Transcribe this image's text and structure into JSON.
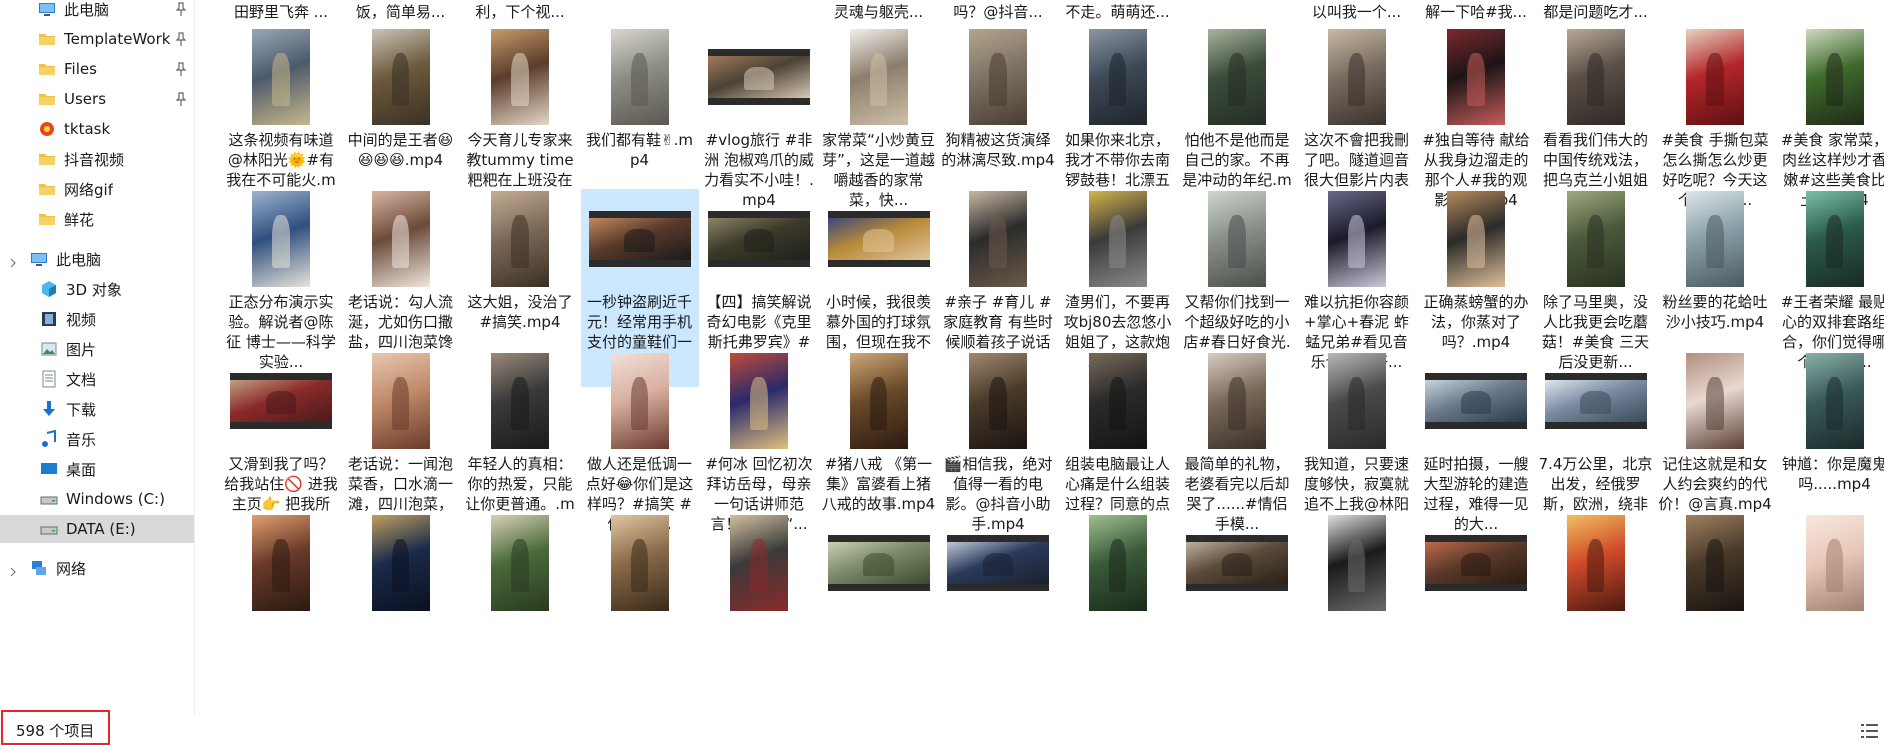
{
  "sidebar": {
    "items": [
      {
        "label": "此电脑",
        "icon": "pc-icon",
        "pinned": true,
        "y": 0
      },
      {
        "label": "TemplateWork",
        "icon": "folder-icon",
        "pinned": true,
        "y": 1
      },
      {
        "label": "Files",
        "icon": "folder-icon",
        "pinned": true,
        "y": 2
      },
      {
        "label": "Users",
        "icon": "folder-icon",
        "pinned": true,
        "y": 3
      },
      {
        "label": "tktask",
        "icon": "app-icon",
        "pinned": false,
        "y": 4
      },
      {
        "label": "抖音视频",
        "icon": "folder-icon",
        "pinned": false,
        "y": 5
      },
      {
        "label": "网络gif",
        "icon": "folder-icon",
        "pinned": false,
        "y": 6
      },
      {
        "label": "鲜花",
        "icon": "folder-icon",
        "pinned": false,
        "y": 7
      }
    ],
    "this_pc": {
      "label": "此电脑"
    },
    "pc_children": [
      {
        "label": "3D 对象",
        "icon": "cube-icon"
      },
      {
        "label": "视频",
        "icon": "video-icon"
      },
      {
        "label": "图片",
        "icon": "picture-icon"
      },
      {
        "label": "文档",
        "icon": "document-icon"
      },
      {
        "label": "下载",
        "icon": "download-icon"
      },
      {
        "label": "音乐",
        "icon": "music-icon"
      },
      {
        "label": "桌面",
        "icon": "desktop-icon"
      },
      {
        "label": "Windows (C:)",
        "icon": "drive-icon"
      },
      {
        "label": "DATA (E:)",
        "icon": "drive-icon",
        "selected": true
      }
    ],
    "network": {
      "label": "网络"
    }
  },
  "files": {
    "top_row": [
      "田野里飞奔 ...",
      "饭，简单易...",
      "利，下个视...",
      "",
      "",
      "灵魂与躯壳...",
      "吗？@抖音...",
      "不走。萌萌还...",
      "",
      "以叫我一个...",
      "解一下哈#我...",
      "都是问题吃才..."
    ],
    "rows": [
      [
        {
          "name": "这条视频有味道@林阳光🌞#有我在不可能火.mp4",
          "kind": "portrait",
          "colors": [
            "#4b5a6b",
            "#9aa7b5",
            "#c7b88a"
          ]
        },
        {
          "name": "中间的是王者😆😆😆😆.mp4",
          "kind": "portrait",
          "colors": [
            "#6e5a3c",
            "#c9c3b8",
            "#3a3024"
          ]
        },
        {
          "name": "今天育儿专家来教tummy time粑粑在上班没在场 遗...",
          "kind": "portrait",
          "colors": [
            "#5a3d2a",
            "#c89b6c",
            "#e5d7c7"
          ]
        },
        {
          "name": "我们都有鞋✌.mp4",
          "kind": "portrait",
          "colors": [
            "#8d8f86",
            "#d9d6cf",
            "#5b5750"
          ]
        },
        {
          "name": "#vlog旅行 #非洲 泡椒鸡爪的威力看实不小哇！.mp4",
          "kind": "landscape",
          "colors": [
            "#4b4235",
            "#a07a58",
            "#d8c8b5"
          ]
        },
        {
          "name": "家常菜“小炒黄豆芽”，这是一道越嚼越香的家常菜，快...",
          "kind": "portrait",
          "colors": [
            "#8b7e6d",
            "#f2f0eb",
            "#cdbfa7"
          ]
        },
        {
          "name": "狗精被这货演绎的淋漓尽致.mp4",
          "kind": "portrait",
          "colors": [
            "#7d7466",
            "#b5a48d",
            "#4a3d31"
          ]
        },
        {
          "name": "如果你来北京，我才不带你去南锣鼓巷！北漂五年...",
          "kind": "portrait",
          "colors": [
            "#3e4a57",
            "#8a96a3",
            "#1e242b"
          ]
        },
        {
          "name": "怕他不是他而是自己的家。不再是冲动的年纪.mp4",
          "kind": "portrait",
          "colors": [
            "#3b4d3a",
            "#a7b39e",
            "#252d24"
          ]
        },
        {
          "name": "这次不會把我刪了吧。隧道迴音很大但影片内表現不...",
          "kind": "portrait",
          "colors": [
            "#7a6d60",
            "#c9b9a6",
            "#3a322b"
          ]
        },
        {
          "name": "#独自等待 献给从我身边溜走的那个人#我的观影报告.mp4",
          "kind": "portrait",
          "colors": [
            "#1c1416",
            "#7a2a2e",
            "#c65d5a"
          ]
        },
        {
          "name": "看看我们伟大的中国传统戏法，把乌克兰小姐姐彻底...",
          "kind": "portrait",
          "colors": [
            "#5a5048",
            "#b8a898",
            "#2f2824"
          ]
        },
        {
          "name": "#美食 手撕包菜怎么撕怎么炒更好吃呢？今天这个小窍门...",
          "kind": "portrait",
          "colors": [
            "#b3262a",
            "#e6d3c2",
            "#5e1013"
          ]
        },
        {
          "name": "#美食 家常菜，肉丝这样炒才香嫩#这些美食比土香.mp4",
          "kind": "portrait",
          "colors": [
            "#3f6b2c",
            "#cfd9c2",
            "#1f2a17"
          ]
        }
      ],
      [
        {
          "name": "正态分布演示实验。解说者@陈征 博士——科学实验...",
          "kind": "portrait",
          "colors": [
            "#2f4f7f",
            "#9db4cf",
            "#e7e4d9"
          ]
        },
        {
          "name": "老话说：勾人流涎，尤如伤口撒盐，四川泡菜馋确食...",
          "kind": "portrait",
          "colors": [
            "#6b4a3a",
            "#d9b6a2",
            "#f0e6de"
          ]
        },
        {
          "name": "这大姐，没治了#搞笑.mp4",
          "kind": "portrait",
          "colors": [
            "#7c6a58",
            "#c4ad94",
            "#3a2f25"
          ]
        },
        {
          "name": "一秒钟盗刷近千元！经常用手机支付的童鞋们一定要...",
          "kind": "landscape",
          "colors": [
            "#5a3a2a",
            "#c08960",
            "#1a1a1a"
          ],
          "selected": true
        },
        {
          "name": "【四】搞笑解说奇幻电影《克里斯托弗罗宾》#电影 #...",
          "kind": "landscape",
          "colors": [
            "#3d3a2a",
            "#8a8566",
            "#20201a"
          ]
        },
        {
          "name": "小时候，我很羡慕外国的打球氛围，但现在我不会，因...",
          "kind": "landscape",
          "colors": [
            "#b88a3a",
            "#3a4a7a",
            "#e0c49a"
          ]
        },
        {
          "name": "#亲子 #育儿 #家庭教育 有些时候顺着孩子说话往往更...",
          "kind": "portrait",
          "colors": [
            "#2b2b2b",
            "#c9b7a3",
            "#6a5a4a"
          ]
        },
        {
          "name": "渣男们，不要再攻bj80去忽悠小姐姐了，这款炮才是真...",
          "kind": "portrait",
          "colors": [
            "#3a3a3a",
            "#d4b44a",
            "#8a8a8a"
          ]
        },
        {
          "name": "又帮你们找到一个超级好吃的小店#春日好食光.mp4",
          "kind": "portrait",
          "colors": [
            "#8a8f8a",
            "#cfd4cf",
            "#4a4f4a"
          ]
        },
        {
          "name": "难以抗拒你容颜+掌心+春泥 蚱蜢兄弟#看见音乐计划 #好...",
          "kind": "portrait",
          "colors": [
            "#1a1a2a",
            "#6a6a8a",
            "#c9c9d9"
          ]
        },
        {
          "name": "正确蒸螃蟹的办法，你蒸对了吗？.mp4",
          "kind": "portrait",
          "colors": [
            "#2a2a2a",
            "#b88a5a",
            "#e0c09a"
          ]
        },
        {
          "name": "除了马里奥，没人比我更会吃蘑菇！#美食 三天后没更新...",
          "kind": "portrait",
          "colors": [
            "#4a5a3a",
            "#a0a880",
            "#2a3020"
          ]
        },
        {
          "name": "粉丝要的花蛤吐沙小技巧.mp4",
          "kind": "portrait",
          "colors": [
            "#8aa0a8",
            "#dce6e8",
            "#4a5a60"
          ]
        },
        {
          "name": "#王者荣耀 最贴心的双排套路组合，你们觉得哪个双排组...",
          "kind": "portrait",
          "colors": [
            "#2a5a4a",
            "#7ac0a8",
            "#1a2a24"
          ]
        }
      ],
      [
        {
          "name": "又滑到我了吗？给我站住🚫 进我主页👉 把我所有...",
          "kind": "landscape",
          "colors": [
            "#8a2a2a",
            "#c0a080",
            "#4a1a1a"
          ]
        },
        {
          "name": "老话说：一闻泡菜香，口水滴一滩，四川泡菜，酸爽...",
          "kind": "portrait",
          "colors": [
            "#c08a6a",
            "#e8c8b0",
            "#6a3a2a"
          ]
        },
        {
          "name": "年轻人的真相：你的热爱，只能让你更普通。.mp4",
          "kind": "portrait",
          "colors": [
            "#3a3a3a",
            "#9a8a7a",
            "#1a1a1a"
          ]
        },
        {
          "name": "做人还是低调一点好😂你们是这样吗？#搞笑 #低调 @...",
          "kind": "portrait",
          "colors": [
            "#d9b0a0",
            "#f0e0d8",
            "#6a3a30"
          ]
        },
        {
          "name": "#何冰 回忆初次拜访岳母，母亲一句话讲师范言！现实版“...",
          "kind": "portrait",
          "colors": [
            "#2a2a6a",
            "#c04a3a",
            "#e0c080"
          ]
        },
        {
          "name": "#猪八戒 《第一集》富婆看上猪八戒的故事.mp4",
          "kind": "portrait",
          "colors": [
            "#6a4a2a",
            "#d0a878",
            "#2a1a10"
          ]
        },
        {
          "name": "🎬相信我，绝对值得一看的电影。@抖音小助手.mp4",
          "kind": "portrait",
          "colors": [
            "#4a3a2a",
            "#a08a70",
            "#1a1410"
          ]
        },
        {
          "name": "组装电脑最让人心痛是什么组装过程？同意的点赞。#...",
          "kind": "portrait",
          "colors": [
            "#2a2a2a",
            "#7a6a5a",
            "#141414"
          ]
        },
        {
          "name": "最简单的礼物，老婆看完以后却哭了......#情侣手模...",
          "kind": "portrait",
          "colors": [
            "#7a6a5a",
            "#d8ccc0",
            "#3a3028"
          ]
        },
        {
          "name": "我知道，只要速度够快，寂寞就追不上我@林阳光🌞...",
          "kind": "portrait",
          "colors": [
            "#4a4a4a",
            "#b8b8b8",
            "#2a2a2a"
          ]
        },
        {
          "name": "延时拍摄，一艘大型游轮的建造过程，难得一见的大...",
          "kind": "landscape",
          "colors": [
            "#6a7a8a",
            "#c8d4dc",
            "#2a3a4a"
          ]
        },
        {
          "name": "7.4万公里，北京出发，经俄罗斯，欧洲，绕非洲大陆...",
          "kind": "landscape",
          "colors": [
            "#7a8aa0",
            "#e0e6ee",
            "#3a4a5a"
          ]
        },
        {
          "name": "记住这就是和女人约会爽约的代价！@言真.mp4",
          "kind": "portrait",
          "colors": [
            "#e8d8d0",
            "#b09080",
            "#5a4038"
          ]
        },
        {
          "name": "钟馗：你是魔鬼吗.....mp4",
          "kind": "portrait",
          "colors": [
            "#3a5a5a",
            "#8ab0a8",
            "#1a2a2a"
          ]
        }
      ],
      [
        {
          "name": "",
          "kind": "portrait",
          "colors": [
            "#6a3a2a",
            "#e0a070",
            "#2a1a10"
          ]
        },
        {
          "name": "",
          "kind": "portrait",
          "colors": [
            "#1a2a4a",
            "#c0a060",
            "#0a1020"
          ]
        },
        {
          "name": "",
          "kind": "portrait",
          "colors": [
            "#4a6a3a",
            "#d8d0b8",
            "#2a3a20"
          ]
        },
        {
          "name": "",
          "kind": "portrait",
          "colors": [
            "#8a6a4a",
            "#e0c8a0",
            "#3a2a1a"
          ]
        },
        {
          "name": "",
          "kind": "portrait",
          "colors": [
            "#3a3a3a",
            "#d0c0a0",
            "#8a2a2a"
          ]
        },
        {
          "name": "",
          "kind": "landscape",
          "colors": [
            "#7a8a6a",
            "#c8d0b0",
            "#3a4a2a"
          ]
        },
        {
          "name": "",
          "kind": "landscape",
          "colors": [
            "#2a3a5a",
            "#c0c8d8",
            "#1a2030"
          ]
        },
        {
          "name": "",
          "kind": "portrait",
          "colors": [
            "#3a5a3a",
            "#a0c090",
            "#1a2a1a"
          ]
        },
        {
          "name": "",
          "kind": "landscape",
          "colors": [
            "#5a4a3a",
            "#c0b0a0",
            "#2a2018"
          ]
        },
        {
          "name": "",
          "kind": "portrait",
          "colors": [
            "#1a1a1a",
            "#e0e0e0",
            "#6a6a6a"
          ]
        },
        {
          "name": "",
          "kind": "landscape",
          "colors": [
            "#5a3a2a",
            "#c06a4a",
            "#2a1a10"
          ]
        },
        {
          "name": "",
          "kind": "portrait",
          "colors": [
            "#d04a2a",
            "#f0c060",
            "#4a1a10"
          ]
        },
        {
          "name": "",
          "kind": "portrait",
          "colors": [
            "#4a3a2a",
            "#a08060",
            "#1a1410"
          ]
        },
        {
          "name": "",
          "kind": "portrait",
          "colors": [
            "#e8c8b8",
            "#f8e8e0",
            "#a08070"
          ]
        }
      ]
    ]
  },
  "status": {
    "item_count": "598 个项目"
  },
  "colors": {
    "selection": "#cce8ff",
    "nav_selected": "#d9d9d9",
    "highlight_border": "#e8262a",
    "folder": "#f0c040"
  }
}
